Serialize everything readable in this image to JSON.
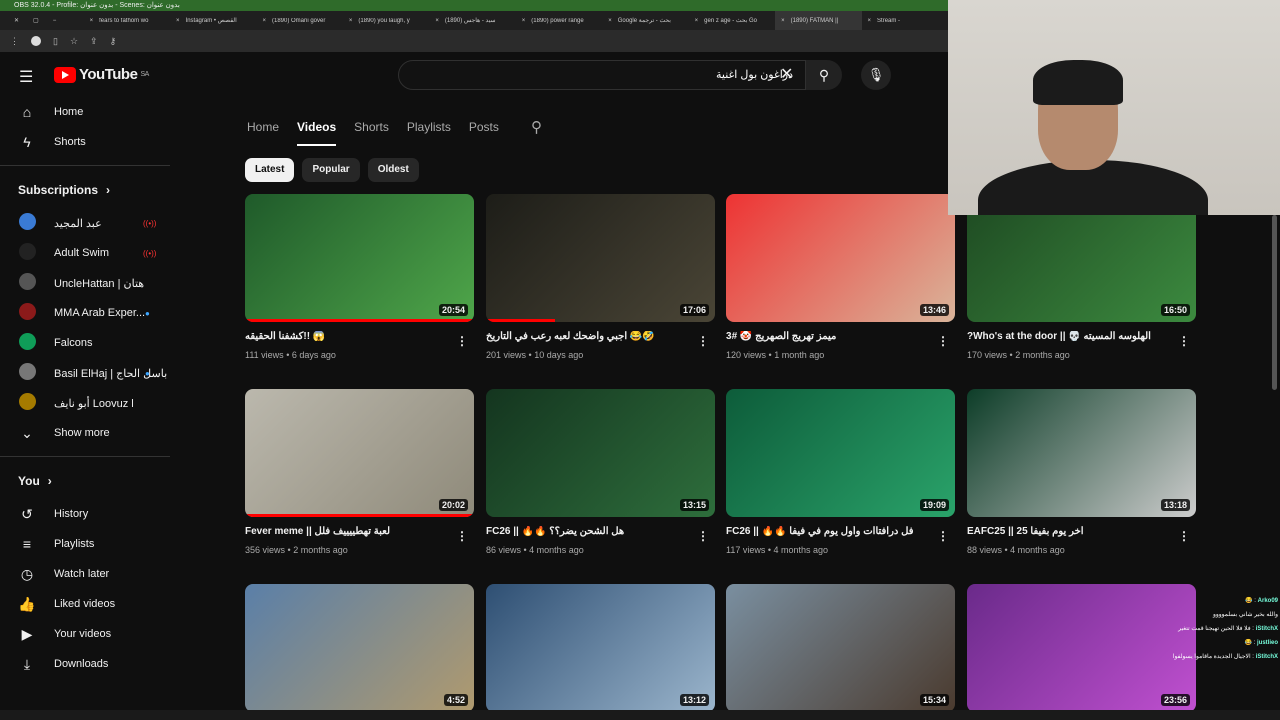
{
  "obs_title": "OBS 32.0.4 - Profile: بدون عنوان - Scenes: بدون عنوان",
  "browser_tabs": [
    "fears to fathom wo",
    "Instagram • القصص",
    "(1890) Omani gover",
    "(1890) you laugh, y",
    "(1890) سيد - هاجس",
    "(1890) power range",
    "Google بحث - ترجمة",
    "gen z age - بحث Go",
    "(1890) FATMAN ||",
    "Stream -"
  ],
  "active_tab_index": 8,
  "header": {
    "logo": "YouTube",
    "region": "SA",
    "search_value": "دراغون بول اغنية"
  },
  "sidebar": {
    "main": [
      {
        "label": "Home",
        "icon": "home-icon"
      },
      {
        "label": "Shorts",
        "icon": "shorts-icon"
      }
    ],
    "subscriptions_title": "Subscriptions",
    "subscriptions": [
      {
        "label": "عبد المجيد",
        "color": "#3a7bd5",
        "status": "live"
      },
      {
        "label": "Adult Swim",
        "color": "#222",
        "status": "live"
      },
      {
        "label": "UncleHattan | هتان",
        "color": "#555",
        "status": ""
      },
      {
        "label": "MMA Arab Exper...",
        "color": "#8b1a1a",
        "status": "new"
      },
      {
        "label": "Falcons",
        "color": "#0f9d58",
        "status": ""
      },
      {
        "label": "Basil ElHaj | باسل الحاج",
        "color": "#777",
        "status": "new"
      },
      {
        "label": "أبو نايف Loovuz l",
        "color": "#a57b00",
        "status": ""
      }
    ],
    "show_more": "Show more",
    "you_title": "You",
    "you": [
      {
        "label": "History",
        "icon": "history-icon"
      },
      {
        "label": "Playlists",
        "icon": "playlists-icon"
      },
      {
        "label": "Watch later",
        "icon": "watch-later-icon"
      },
      {
        "label": "Liked videos",
        "icon": "like-icon"
      },
      {
        "label": "Your videos",
        "icon": "your-videos-icon"
      },
      {
        "label": "Downloads",
        "icon": "download-icon"
      }
    ]
  },
  "channel_tabs": [
    "Home",
    "Videos",
    "Shorts",
    "Playlists",
    "Posts"
  ],
  "active_channel_tab": "Videos",
  "chips": [
    "Latest",
    "Popular",
    "Oldest"
  ],
  "videos": [
    {
      "title": "😱 !!كشفنا الحقيقه",
      "views": "111 views",
      "age": "6 days ago",
      "duration": "20:54",
      "progress": 1,
      "colors": [
        "#1f5a2a",
        "#4fa64a"
      ]
    },
    {
      "title": "🤣😂 اجبي واضحك لعبه رعب في التاريخ",
      "views": "201 views",
      "age": "10 days ago",
      "duration": "17:06",
      "progress": 0.3,
      "colors": [
        "#1d1d18",
        "#4a4536"
      ]
    },
    {
      "title": "ميمز تهريج الصهريج 🤡 #3",
      "views": "120 views",
      "age": "1 month ago",
      "duration": "13:46",
      "progress": 0,
      "colors": [
        "#e33",
        "#d9b49a"
      ]
    },
    {
      "title": "الهلوسه المسيته 💀 || Who's at the door?",
      "views": "170 views",
      "age": "2 months ago",
      "duration": "16:50",
      "progress": 0,
      "colors": [
        "#1e4a22",
        "#3c8a3f"
      ]
    },
    {
      "title": "لعبة تهطييييف فلل || Fever meme",
      "views": "356 views",
      "age": "2 months ago",
      "duration": "20:02",
      "progress": 1,
      "colors": [
        "#bbb8ad",
        "#8f8a7a"
      ]
    },
    {
      "title": "هل الشحن يضر؟؟ 🔥🔥 || FC26",
      "views": "86 views",
      "age": "4 months ago",
      "duration": "13:15",
      "progress": 0,
      "colors": [
        "#14351f",
        "#2e6e3c"
      ]
    },
    {
      "title": "فل درافتاات وأول يوم في فيفا 🔥🔥 || FC26",
      "views": "117 views",
      "age": "4 months ago",
      "duration": "19:09",
      "progress": 0,
      "colors": [
        "#0d5c3a",
        "#2aa36a"
      ]
    },
    {
      "title": "اخر يوم بفيفا 25 || EAFC25",
      "views": "88 views",
      "age": "4 months ago",
      "duration": "13:18",
      "progress": 0,
      "colors": [
        "#0d3d28",
        "#ccc"
      ]
    },
    {
      "title": "",
      "views": "",
      "age": "",
      "duration": "4:52",
      "progress": 0,
      "colors": [
        "#5a7fa8",
        "#b09a6e"
      ]
    },
    {
      "title": "",
      "views": "",
      "age": "",
      "duration": "13:12",
      "progress": 0,
      "colors": [
        "#2e4f73",
        "#9bb5cc"
      ]
    },
    {
      "title": "",
      "views": "",
      "age": "",
      "duration": "15:34",
      "progress": 0,
      "colors": [
        "#7a8fa0",
        "#4a3a2e"
      ]
    },
    {
      "title": "",
      "views": "",
      "age": "",
      "duration": "23:56",
      "progress": 0,
      "colors": [
        "#6a2a8a",
        "#c050d0"
      ]
    }
  ],
  "chat": [
    {
      "user": "Arko09",
      "msg": "😂"
    },
    {
      "user": "",
      "msg": "والله بخير شاني بسلموووو"
    },
    {
      "user": "iStitchX",
      "msg": "فلا فلا الحين تهيجنا قمت تتغير"
    },
    {
      "user": "justlieo",
      "msg": "😂"
    },
    {
      "user": "iStitchX",
      "msg": "الاجيال الجديدة ماقاموا يسولفوا"
    }
  ]
}
